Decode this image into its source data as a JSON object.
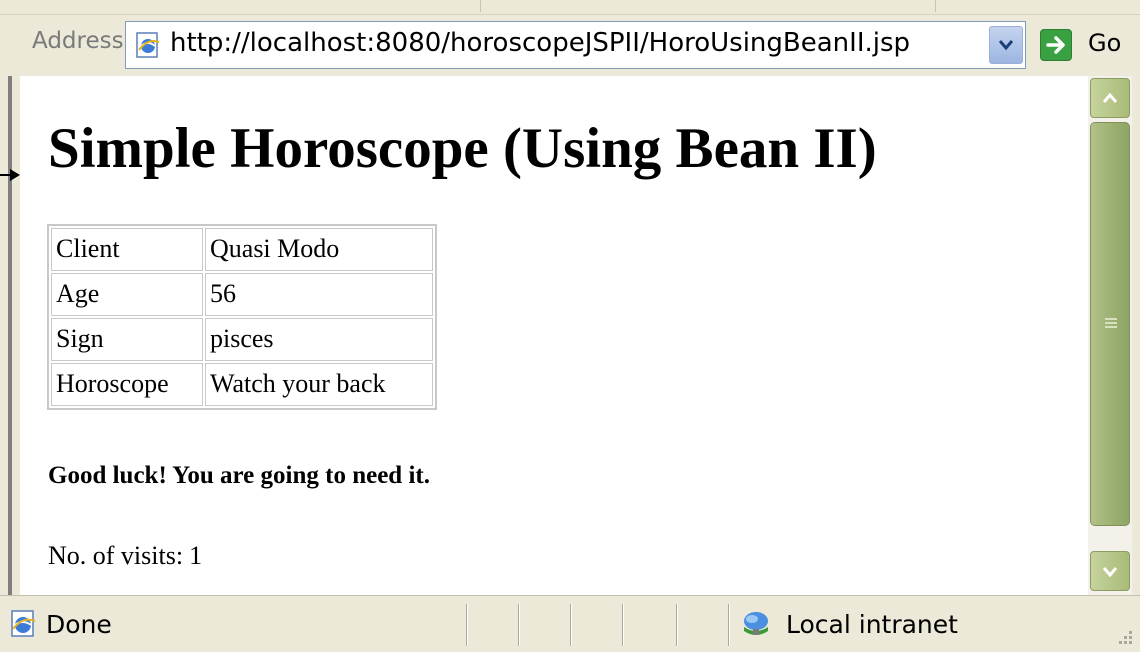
{
  "address_bar": {
    "label": "Address",
    "url": "http://localhost:8080/horoscopeJSPII/HoroUsingBeanII.jsp",
    "go_label": "Go"
  },
  "page": {
    "title": "Simple Horoscope (Using Bean II)",
    "table": [
      {
        "key": "Client",
        "value": "Quasi Modo"
      },
      {
        "key": "Age",
        "value": "56"
      },
      {
        "key": "Sign",
        "value": "pisces"
      },
      {
        "key": "Horoscope",
        "value": "Watch your back"
      }
    ],
    "message": "Good luck! You are going to need it.",
    "visits_label": "No. of visits:",
    "visits_count": "1"
  },
  "status_bar": {
    "status": "Done",
    "zone": "Local intranet"
  },
  "icons": {
    "page": "ie-page-icon",
    "dropdown": "chevron-down-icon",
    "go": "arrow-right-icon",
    "zone": "local-intranet-icon",
    "scroll_up": "chevron-up-icon",
    "scroll_down": "chevron-down-icon"
  },
  "colors": {
    "chrome": "#ECE9D8",
    "scrollbar_thumb": "#9AAF70",
    "go_green": "#3AA142",
    "address_border": "#7F9DB9"
  }
}
